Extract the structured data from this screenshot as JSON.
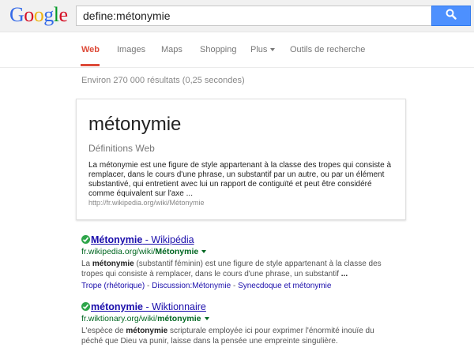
{
  "logo": [
    "G",
    "o",
    "o",
    "g",
    "l",
    "e"
  ],
  "logo_colors": [
    "#3369e8",
    "#d50f25",
    "#eeb211",
    "#3369e8",
    "#009925",
    "#d50f25"
  ],
  "search": {
    "query": "define:métonymie"
  },
  "tabs": [
    {
      "label": "Web"
    },
    {
      "label": "Images"
    },
    {
      "label": "Maps"
    },
    {
      "label": "Shopping"
    },
    {
      "label": "Plus"
    },
    {
      "label": "Outils de recherche"
    }
  ],
  "stats": "Environ 270 000 résultats (0,25 secondes)",
  "definition": {
    "term": "métonymie",
    "subtitle": "Définitions Web",
    "text": "La métonymie est une figure de style appartenant à la classe des tropes qui consiste à remplacer, dans le cours d'une phrase, un substantif par un autre, ou par un élément substantivé, qui entretient avec lui un rapport de contiguïté et peut être considéré comme équivalent sur l'axe ...",
    "source": "http://fr.wikipedia.org/wiki/Métonymie"
  },
  "results": [
    {
      "title_bold": "Métonymie",
      "title_rest": " - Wikipédia",
      "url_plain": "fr.wikipedia.org/wiki/",
      "url_bold": "Métonymie",
      "snippet": [
        {
          "t": "La "
        },
        {
          "t": "métonymie",
          "b": true
        },
        {
          "t": " (substantif féminin) est une figure de style appartenant à la classe des tropes qui consiste à remplacer, dans le cours d'une phrase, un substantif "
        },
        {
          "t": "...",
          "b": true
        }
      ],
      "sitelinks": [
        "Trope (rhétorique)",
        "Discussion:Métonymie",
        "Synecdoque et métonymie"
      ]
    },
    {
      "title_bold": "métonymie",
      "title_rest": " - Wiktionnaire",
      "url_plain": "fr.wiktionary.org/wiki/",
      "url_bold": "métonymie",
      "snippet": [
        {
          "t": "L'espèce de "
        },
        {
          "t": "métonymie",
          "b": true
        },
        {
          "t": " scripturale employée ici pour exprimer l'énormité inouïe du péché que Dieu va punir, laisse dans la pensée une empreinte singulière."
        }
      ],
      "sitelinks": []
    }
  ]
}
